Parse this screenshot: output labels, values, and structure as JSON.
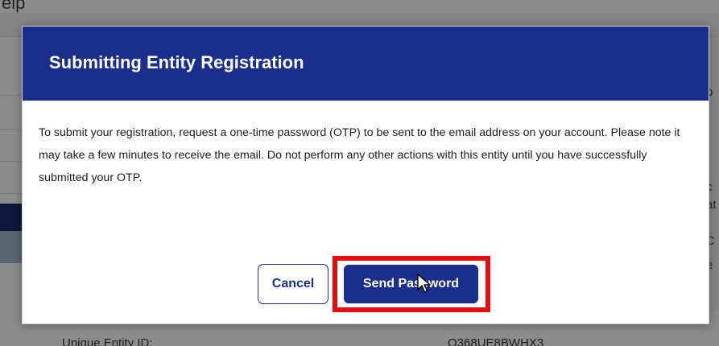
{
  "background": {
    "help_text": "elp",
    "right_col_fragments": [
      "o",
      "c",
      "at",
      "C",
      "e"
    ],
    "unique_entity_label": "Unique Entity ID:",
    "unique_entity_value": "Q368UE8BWHX3"
  },
  "modal": {
    "title": "Submitting Entity Registration",
    "body": "To submit your registration, request a one-time password (OTP) to be sent to the email address on your account. Please note it may take a few minutes to receive the email. Do not perform any other actions with this entity until you have successfully submitted your OTP.",
    "cancel_label": "Cancel",
    "send_password_label": "Send Password"
  },
  "colors": {
    "header_navy": "#1b2e8c",
    "highlight_red": "#e01010"
  },
  "icons": {
    "cursor": "mouse-pointer-icon"
  }
}
